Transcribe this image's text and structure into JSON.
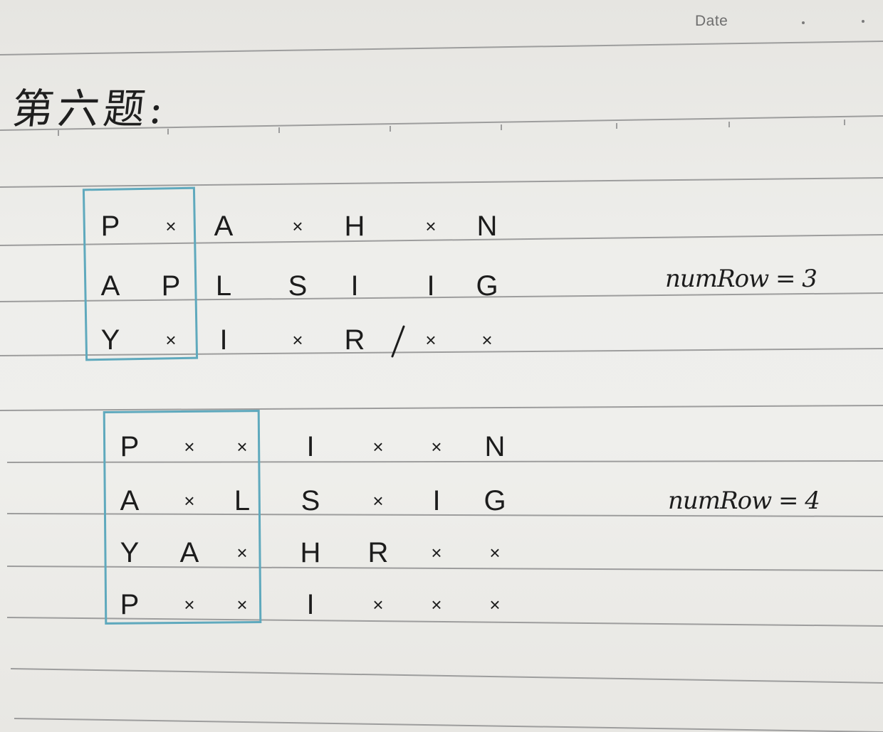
{
  "header": {
    "date_label": "Date"
  },
  "title": "第六题:",
  "annotation_color": "#5fa9bd",
  "example1": {
    "rows": [
      [
        "P",
        "×",
        "A",
        "×",
        "H",
        "×",
        "N"
      ],
      [
        "A",
        "P",
        "L",
        "S",
        "I",
        "I",
        "G"
      ],
      [
        "Y",
        "×",
        "I",
        "×",
        "R",
        "×",
        "×"
      ]
    ],
    "note": "numRow = 3"
  },
  "example2": {
    "rows": [
      [
        "P",
        "×",
        "×",
        "I",
        "×",
        "×",
        "N"
      ],
      [
        "A",
        "×",
        "L",
        "S",
        "×",
        "I",
        "G"
      ],
      [
        "Y",
        "A",
        "×",
        "H",
        "R",
        "×",
        "×"
      ],
      [
        "P",
        "×",
        "×",
        "I",
        "×",
        "×",
        "×"
      ]
    ],
    "note": "numRow = 4"
  }
}
